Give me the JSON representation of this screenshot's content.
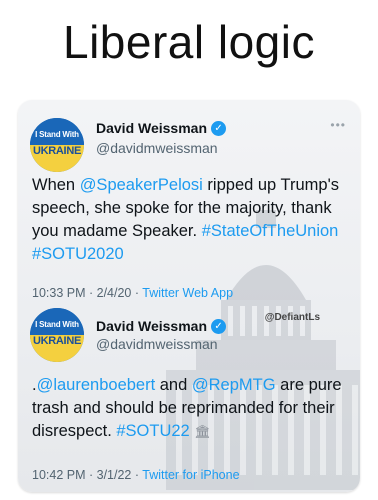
{
  "meme": {
    "title": "Liberal logic"
  },
  "watermark": "@DefiantLs",
  "tweets": [
    {
      "avatar": {
        "line1": "I Stand With",
        "line2": "UKRAINE"
      },
      "display_name": "David Weissman",
      "handle": "@davidmweissman",
      "body": {
        "t1": "When ",
        "m1": "@SpeakerPelosi",
        "t2": " ripped up Trump's speech, she spoke for the majority, thank you madame Speaker. ",
        "h1": "#StateOfTheUnion",
        "t3": " ",
        "h2": "#SOTU2020"
      },
      "time": "10:33 PM · 2/4/20 · ",
      "source": "Twitter Web App"
    },
    {
      "avatar": {
        "line1": "I Stand With",
        "line2": "UKRAINE"
      },
      "display_name": "David Weissman",
      "handle": "@davidmweissman",
      "body": {
        "t1": ".",
        "m1": "@laurenboebert",
        "t2": " and ",
        "m2": "@RepMTG",
        "t3": " are pure trash and should be reprimanded for their disrespect. ",
        "h1": "#SOTU22"
      },
      "time": "10:42 PM · 3/1/22 · ",
      "source": "Twitter for iPhone"
    }
  ],
  "icons": {
    "verified": "verified-badge-icon",
    "more": "more-options-icon",
    "capitol": "capitol-building-icon",
    "hashflag": "capitol-hashflag-icon"
  },
  "colors": {
    "link": "#1d9bf0",
    "secondary": "#536471",
    "verified": "#1d9bf0"
  }
}
